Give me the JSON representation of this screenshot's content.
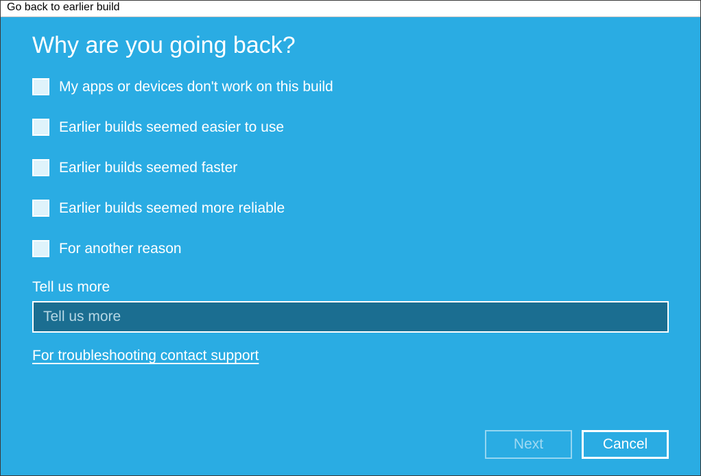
{
  "window": {
    "title": "Go back to earlier build"
  },
  "heading": "Why are you going back?",
  "options": [
    {
      "label": "My apps or devices don't work on this build"
    },
    {
      "label": "Earlier builds seemed easier to use"
    },
    {
      "label": "Earlier builds seemed faster"
    },
    {
      "label": "Earlier builds seemed more reliable"
    },
    {
      "label": "For another reason"
    }
  ],
  "tell_more": {
    "label": "Tell us more",
    "placeholder": "Tell us more",
    "value": ""
  },
  "support_link": "For troubleshooting contact support",
  "buttons": {
    "next": "Next",
    "cancel": "Cancel"
  }
}
